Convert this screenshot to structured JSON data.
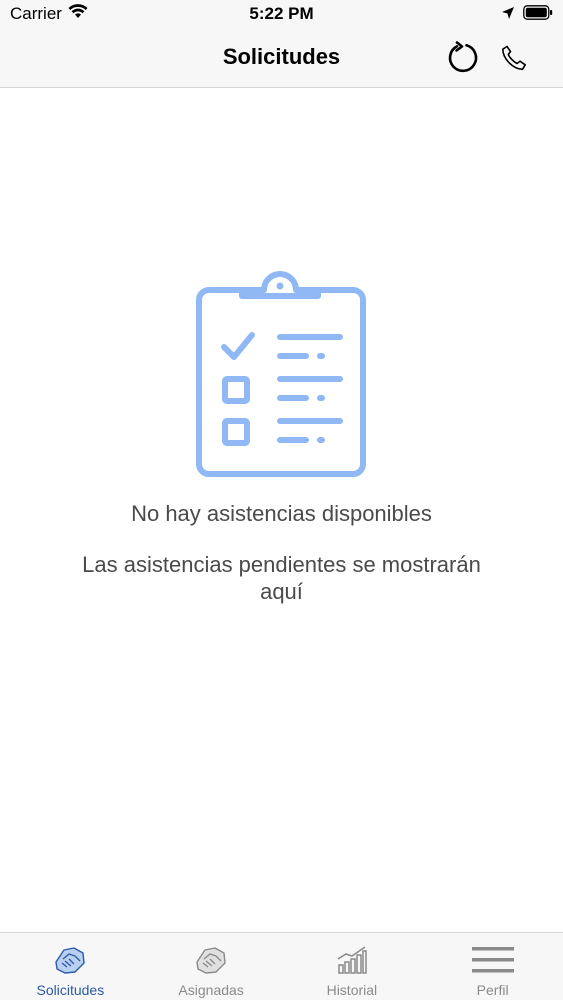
{
  "status_bar": {
    "carrier": "Carrier",
    "time": "5:22 PM"
  },
  "nav": {
    "title": "Solicitudes",
    "actions": [
      {
        "icon": "refresh-icon"
      },
      {
        "icon": "phone-icon"
      }
    ]
  },
  "empty_state": {
    "icon": "clipboard-checklist-icon",
    "title": "No hay asistencias disponibles",
    "subtitle": "Las asistencias pendientes se mostrarán aquí"
  },
  "tabs": [
    {
      "label": "Solicitudes",
      "icon": "handshake-icon",
      "active": true
    },
    {
      "label": "Asignadas",
      "icon": "handshake-icon",
      "active": false
    },
    {
      "label": "Historial",
      "icon": "bar-chart-icon",
      "active": false
    },
    {
      "label": "Perfil",
      "icon": "menu-icon",
      "active": false
    }
  ],
  "colors": {
    "accent": "#2f5aa8",
    "illustration": "#8fb8f5",
    "inactive": "#8a8a8a"
  }
}
